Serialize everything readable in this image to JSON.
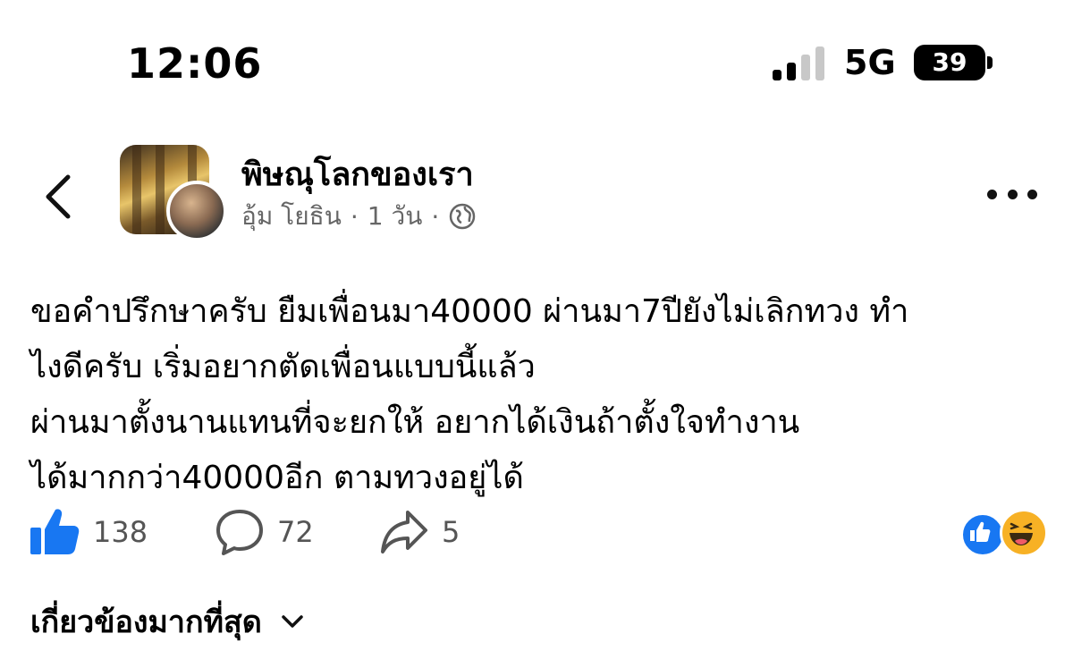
{
  "status_bar": {
    "time": "12:06",
    "network": "5G",
    "battery": "39"
  },
  "header": {
    "group_name": "พิษณุโลกของเรา",
    "author": "อุ้ม โยธิน",
    "separator": "·",
    "time_ago": "1 วัน",
    "icons": {
      "back": "chevron-left-icon",
      "privacy": "globe-icon",
      "more": "more-dots-icon"
    }
  },
  "post": {
    "lines": [
      "ขอคำปรึกษาครับ ยืมเพื่อนมา40000 ผ่านมา7ปียังไม่เลิกทวง ทำ",
      "ไงดีครับ เริ่มอยากตัดเพื่อนแบบนี้แล้ว",
      "ผ่านมาตั้งนานแทนที่จะยกให้ อยากได้เงินถ้าตั้งใจทำงาน",
      "ได้มากกว่า40000อีก ตามทวงอยู่ได้"
    ]
  },
  "actions": {
    "likes": "138",
    "comments": "72",
    "shares": "5",
    "accent_color": "#1877f2"
  },
  "related": {
    "label": "เกี่ยวข้องมากที่สุด"
  }
}
